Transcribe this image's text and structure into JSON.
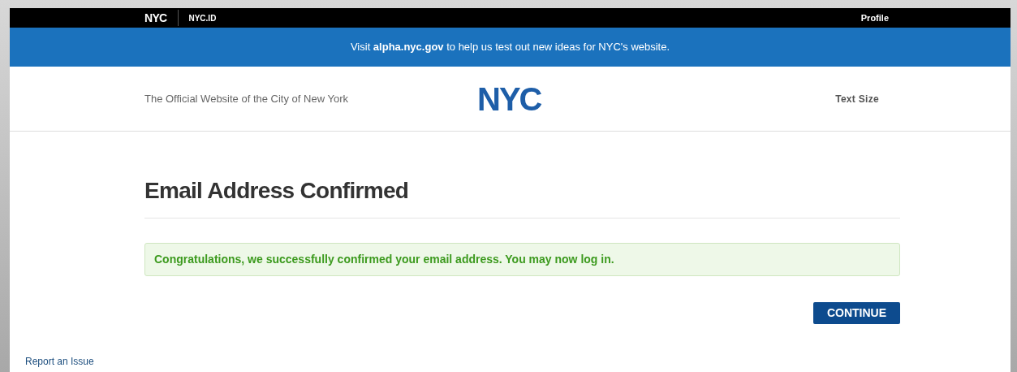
{
  "top_bar": {
    "logo": "NYC",
    "app_name": "NYC.ID",
    "profile_link": "Profile"
  },
  "banner": {
    "text": "Visit **alpha.nyc.gov** to help us test out new ideas for NYC's website."
  },
  "header": {
    "tagline": "The Official Website of the City of New York",
    "logo": "NYC",
    "text_size": "Text Size"
  },
  "main": {
    "heading": "Email Address Confirmed",
    "alert": {
      "kind": "success",
      "text": "Congratulations, we successfully confirmed your email address. You may now log in."
    },
    "button": "CONTINUE"
  },
  "footer": {
    "report_link": "Report an Issue"
  }
}
